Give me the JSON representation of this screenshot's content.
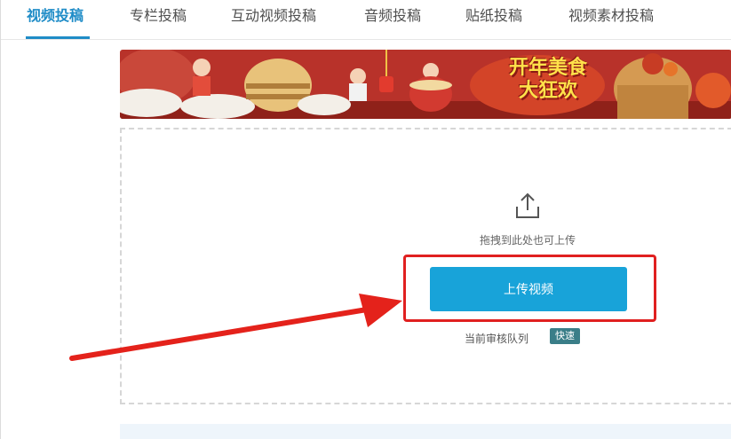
{
  "tabs": [
    {
      "label": "视频投稿",
      "active": true
    },
    {
      "label": "专栏投稿",
      "active": false
    },
    {
      "label": "互动视频投稿",
      "active": false
    },
    {
      "label": "音频投稿",
      "active": false
    },
    {
      "label": "贴纸投稿",
      "active": false
    },
    {
      "label": "视频素材投稿",
      "active": false
    }
  ],
  "banner": {
    "text_line1": "开年美食",
    "text_line2": "大狂欢"
  },
  "upload": {
    "icon": "upload-icon",
    "drag_hint": "拖拽到此处也可上传",
    "button_label": "上传视频",
    "queue_label": "当前审核队列",
    "queue_status": "快速"
  },
  "colors": {
    "accent": "#1f8cc7",
    "button": "#18a3d9",
    "highlight": "#e02020",
    "badge": "#3a7e88"
  }
}
